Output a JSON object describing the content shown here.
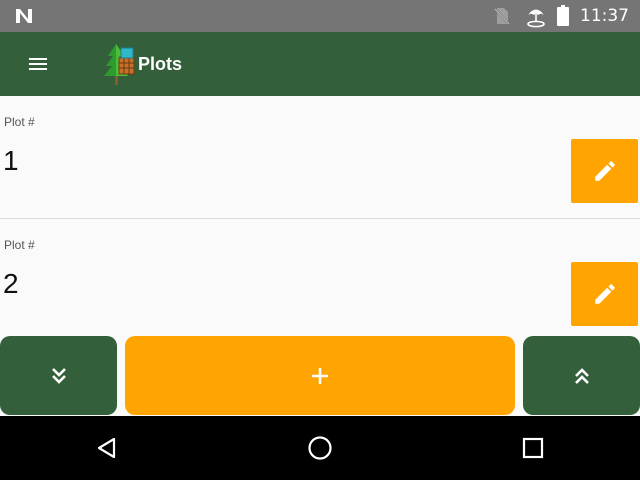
{
  "status_bar": {
    "time": "11:37",
    "icons": [
      "n-logo-icon",
      "no-sim-icon",
      "umbrella-icon",
      "battery-icon"
    ]
  },
  "app_bar": {
    "title": "Plots",
    "menu_icon": "menu-icon",
    "logo_icon": "tree-logo-icon",
    "background": "#33603a"
  },
  "plots": [
    {
      "label": "Plot #",
      "value": "1",
      "action_icon": "pencil-icon"
    },
    {
      "label": "Plot #",
      "value": "2",
      "action_icon": "pencil-icon"
    }
  ],
  "actions": {
    "scroll_down_icon": "double-chevron-down-icon",
    "add_icon": "plus-icon",
    "scroll_up_icon": "double-chevron-up-icon",
    "accent": "#ffa400",
    "primary": "#33603a"
  },
  "nav_bar": {
    "icons": [
      "back-triangle-icon",
      "home-circle-icon",
      "recents-square-icon"
    ]
  }
}
